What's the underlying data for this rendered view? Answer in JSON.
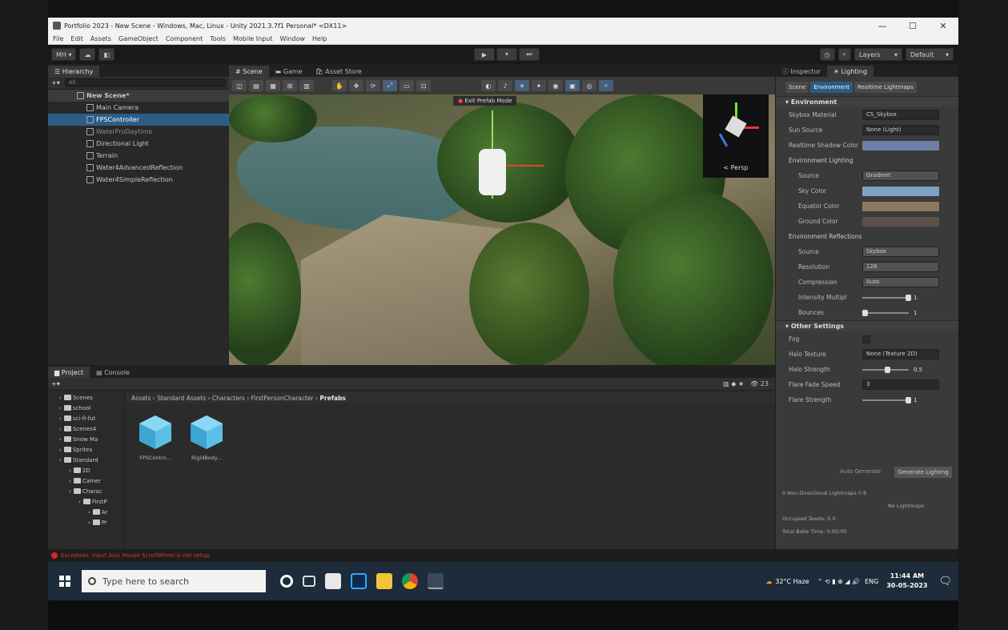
{
  "window": {
    "title": "Portfolio 2023 - New Scene - Windows, Mac, Linux - Unity 2021.3.7f1 Personal* <DX11>",
    "controls": [
      "—",
      "☐",
      "✕"
    ]
  },
  "menu": [
    "File",
    "Edit",
    "Assets",
    "GameObject",
    "Component",
    "Tools",
    "Mobile Input",
    "Window",
    "Help"
  ],
  "toolbar": {
    "account": "MH ▾",
    "play": "▶",
    "pause": "⏸",
    "step": "⏭",
    "layers": "Layers",
    "layout": "Default"
  },
  "hierarchy": {
    "tab": "Hierarchy",
    "search_placeholder": "All",
    "scene": "New Scene*",
    "items": [
      {
        "label": "Main Camera",
        "selected": false,
        "dim": false
      },
      {
        "label": "FPSController",
        "selected": true,
        "dim": false
      },
      {
        "label": "WaterProDaytime",
        "selected": false,
        "dim": true
      },
      {
        "label": "Directional Light",
        "selected": false,
        "dim": false
      },
      {
        "label": "Terrain",
        "selected": false,
        "dim": false
      },
      {
        "label": "Water4AdvancedReflection",
        "selected": false,
        "dim": false
      },
      {
        "label": "Water4SimpleReflection",
        "selected": false,
        "dim": false
      }
    ]
  },
  "scene_view": {
    "tabs": [
      "Scene",
      "Game",
      "Asset Store"
    ],
    "notice": "Exit Prefab Mode",
    "gizmo_label": "< Persp"
  },
  "project": {
    "tabs": [
      "Project",
      "Console"
    ],
    "folders": [
      "Scenes",
      "school",
      "sci-fi-fut",
      "Scenes4",
      "Snow Ma",
      "Sprites",
      "Standard",
      "2D",
      "Camer",
      "Charac",
      "FirstP",
      "Ar",
      "Pr"
    ],
    "breadcrumb": [
      "Assets",
      "Standard Assets",
      "Characters",
      "FirstPersonCharacter"
    ],
    "breadcrumb_current": "Prefabs",
    "assets": [
      "FPSContro...",
      "RigidBody..."
    ]
  },
  "inspector": {
    "tabs": [
      "Inspector",
      "Lighting"
    ],
    "lighting_tabs": [
      "Scene",
      "Environment",
      "Realtime Lightmaps"
    ],
    "environment": {
      "header": "Environment",
      "skybox_label": "Skybox Material",
      "skybox_value": "CS_Skybox",
      "sun_label": "Sun Source",
      "sun_value": "None (Light)",
      "shadow_label": "Realtime Shadow Color"
    },
    "env_lighting": {
      "header": "Environment Lighting",
      "source_label": "Source",
      "source_value": "Gradient",
      "sky_label": "Sky Color",
      "equator_label": "Equator Color",
      "ground_label": "Ground Color"
    },
    "env_reflections": {
      "header": "Environment Reflections",
      "source_label": "Source",
      "source_value": "Skybox",
      "resolution_label": "Resolution",
      "resolution_value": "128",
      "compression_label": "Compression",
      "compression_value": "Auto",
      "intensity_label": "Intensity Multipl",
      "intensity_value": "1",
      "bounces_label": "Bounces",
      "bounces_value": "1"
    },
    "other": {
      "header": "Other Settings",
      "fog_label": "Fog",
      "halo_label": "Halo Texture",
      "halo_value": "None (Texture 2D)",
      "halo_strength_label": "Halo Strength",
      "halo_strength_value": "0.5",
      "flare_fade_label": "Flare Fade Speed",
      "flare_fade_value": "3",
      "flare_strength_label": "Flare Strength",
      "flare_strength_value": "1"
    },
    "auto_generate": "Auto Generate",
    "generate_button": "Generate Lighting",
    "footer": [
      "0 Non-Directional Lightmaps      0 B",
      "No Lightmaps",
      "Occupied Texels: 0.0",
      "Total Bake Time: 0:00:00"
    ]
  },
  "status": {
    "error": "Exception: Input Axis Mouse ScrollWheel is not setup."
  },
  "taskbar": {
    "search": "Type here to search",
    "weather": "32°C  Haze",
    "lang": "ENG",
    "time": "11:44 AM",
    "date": "30-05-2023"
  },
  "colors": {
    "selection": "#2c5d87",
    "sky_color": "#7fa1c4",
    "equator_color": "#8a7a5e",
    "ground_color": "#5e4f48",
    "shadow_color": "#6c7fa6",
    "error": "#d63a2a"
  }
}
